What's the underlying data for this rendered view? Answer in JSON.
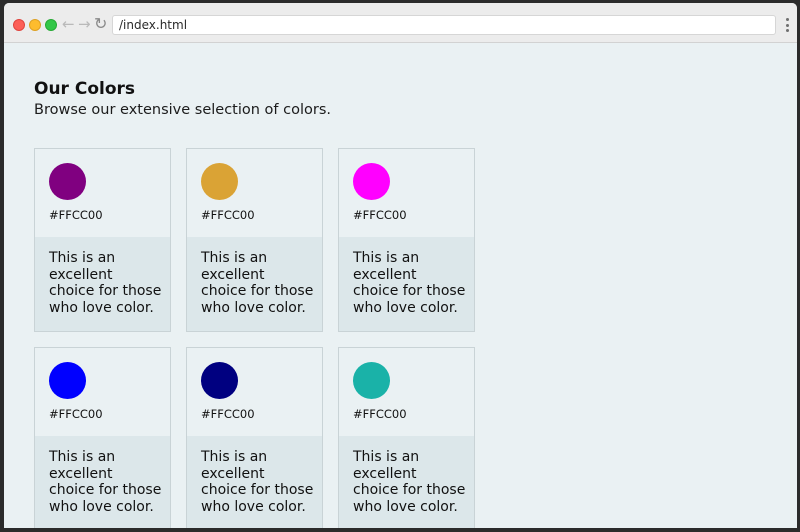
{
  "browser": {
    "address": "/index.html",
    "back_glyph": "←",
    "forward_glyph": "→",
    "reload_glyph": "↻"
  },
  "page": {
    "title": "Our Colors",
    "subtitle": "Browse our extensive selection of colors."
  },
  "cards": [
    {
      "color": "#800080",
      "hex_label": "#FFCC00",
      "description": "This is an excellent choice for those who love color."
    },
    {
      "color": "#DAA335",
      "hex_label": "#FFCC00",
      "description": "This is an excellent choice for those who love color."
    },
    {
      "color": "#FF00FF",
      "hex_label": "#FFCC00",
      "description": "This is an excellent choice for those who love color."
    },
    {
      "color": "#0000FF",
      "hex_label": "#FFCC00",
      "description": "This is an excellent choice for those who love color."
    },
    {
      "color": "#000080",
      "hex_label": "#FFCC00",
      "description": "This is an excellent choice for those who love color."
    },
    {
      "color": "#1AB2A8",
      "hex_label": "#FFCC00",
      "description": "This is an excellent choice for those who love color."
    }
  ]
}
